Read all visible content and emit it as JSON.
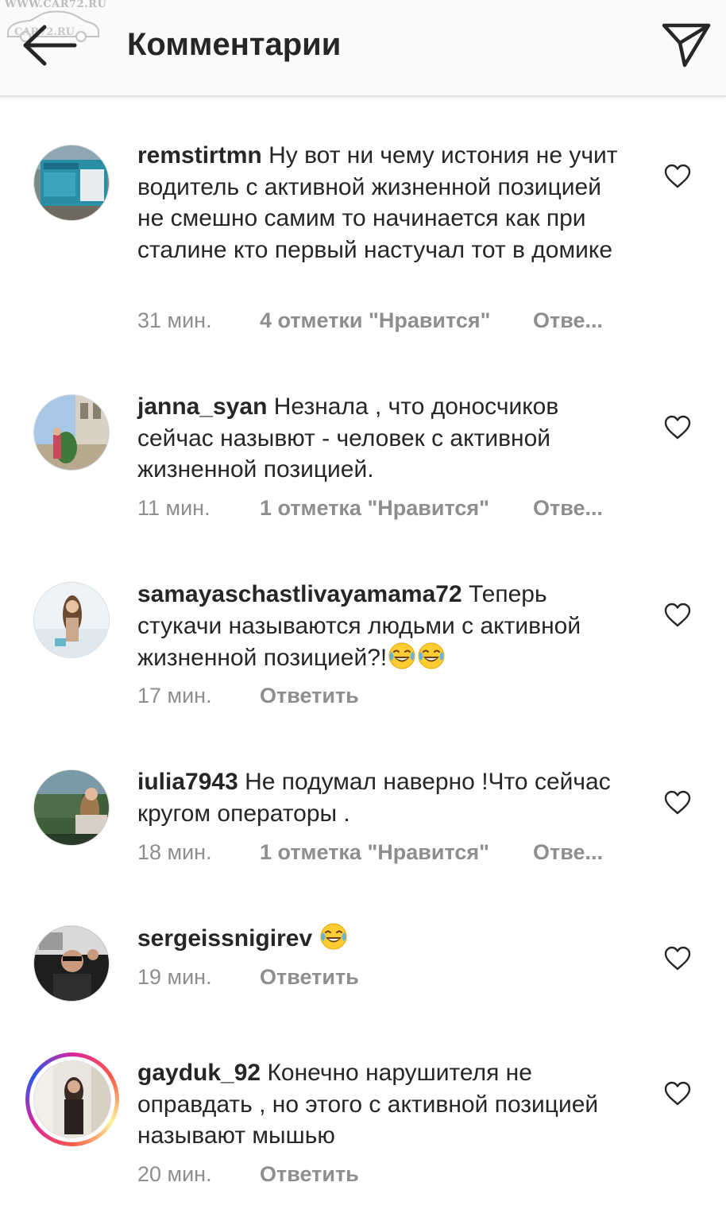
{
  "watermark": {
    "top_text": "WWW.CAR72.RU",
    "logo_text": "CAR72.RU"
  },
  "header": {
    "title": "Комментарии",
    "back_icon": "arrow-left-icon",
    "send_icon": "paper-plane-icon"
  },
  "comments": [
    {
      "username": "remstirtmn",
      "text": "Ну вот ни чему истония не учит водитель с активной жизненной позицией не смешно самим то начинается как при сталине кто первый настучал тот в домике",
      "time": "31 мин.",
      "likes": "4 отметки \"Нравится\"",
      "reply": "Отве..."
    },
    {
      "username": "janna_syan",
      "text": "Незнала , что доносчиков сейчас назывют - человек с активной жизненной позицией.",
      "time": "11 мин.",
      "likes": "1 отметка \"Нравится\"",
      "reply": "Отве..."
    },
    {
      "username": "samayaschastlivayamama72",
      "text": "Теперь стукачи называются людьми с активной жизненной позицией?!",
      "time": "17 мин.",
      "likes": "",
      "reply": "Ответить"
    },
    {
      "username": "iulia7943",
      "text": "Не подумал наверно !Что сейчас кругом операторы .",
      "time": "18 мин.",
      "likes": "1 отметка \"Нравится\"",
      "reply": "Отве..."
    },
    {
      "username": "sergeissnigirev",
      "text": "",
      "time": "19 мин.",
      "likes": "",
      "reply": "Ответить"
    },
    {
      "username": "gayduk_92",
      "text": "Конечно нарушителя не оправдать , но этого с активной позицией называют мышью",
      "time": "20 мин.",
      "likes": "",
      "reply": "Ответить"
    }
  ],
  "icons": {
    "like": "heart-outline-icon",
    "emoji": "tears-of-joy-emoji-icon"
  },
  "colors": {
    "text": "#262626",
    "meta": "#8e8e8e",
    "header_bg": "#fafafa"
  }
}
